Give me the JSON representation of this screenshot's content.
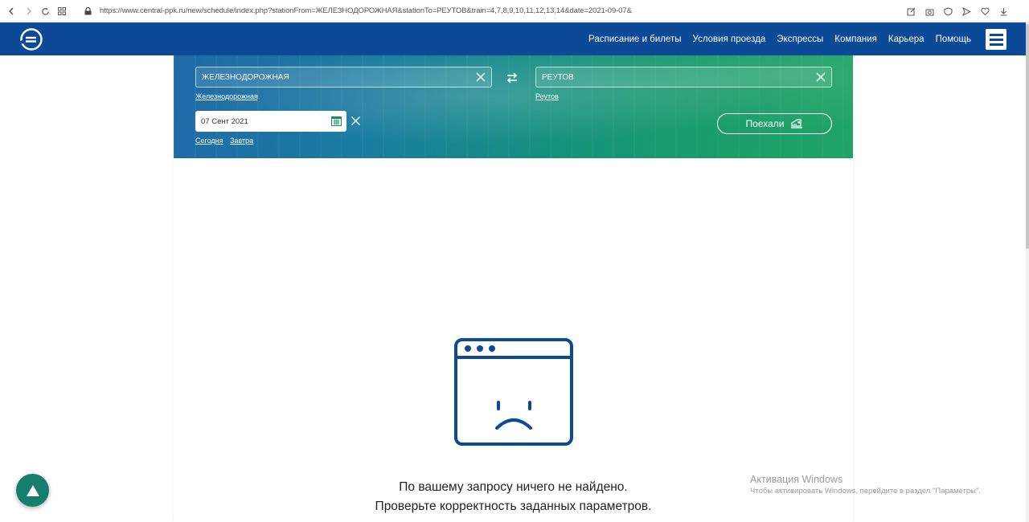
{
  "browser": {
    "url": "https://www.central-ppk.ru/new/schedule/index.php?stationFrom=ЖЕЛЕЗНОДОРОЖНАЯ&stationTo=РЕУТОВ&train=4,7,8,9,10,11,12,13,14&date=2021-09-07&"
  },
  "header": {
    "nav": [
      "Расписание и билеты",
      "Условия проезда",
      "Экспрессы",
      "Компания",
      "Карьера",
      "Помощь"
    ]
  },
  "search": {
    "from_value": "ЖЕЛЕЗНОДОРОЖНАЯ",
    "from_link": "Железнодорожная",
    "to_value": "РЕУТОВ",
    "to_link": "Реутов",
    "date_value": "07 Сент 2021",
    "today_link": "Сегодня",
    "tomorrow_link": "Завтра",
    "go_label": "Поехали"
  },
  "result": {
    "line1": "По вашему запросу ничего не найдено.",
    "line2": "Проверьте корректность заданных параметров."
  },
  "watermark": {
    "title": "Активация Windows",
    "subtitle": "Чтобы активировать Windows, перейдите в раздел \"Параметры\"."
  },
  "colors": {
    "header_bg": "#0c4a97",
    "icon_blue": "#0c4a97",
    "float_btn": "#167e6c"
  }
}
